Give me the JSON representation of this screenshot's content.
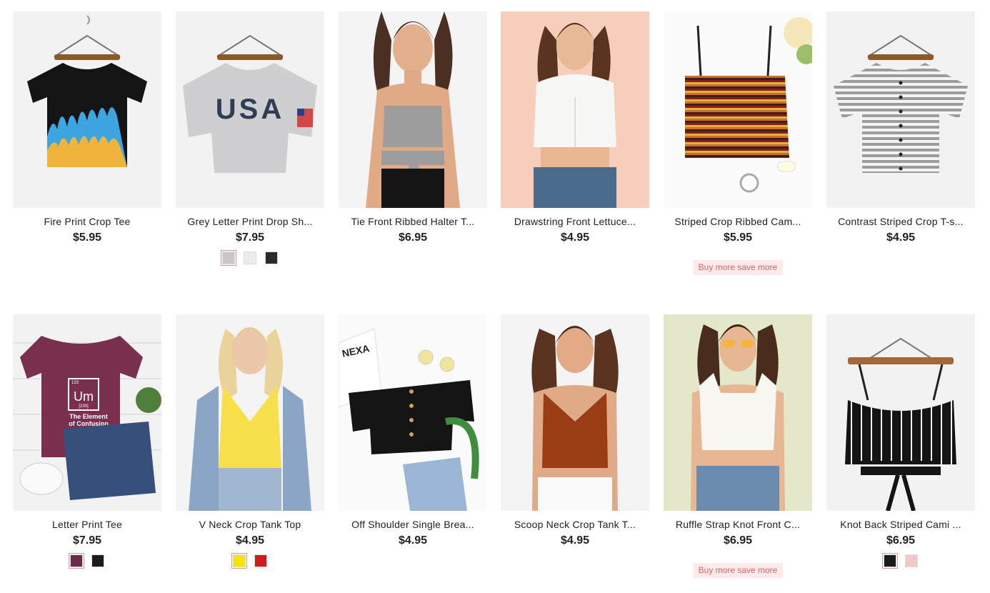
{
  "products": [
    {
      "title": "Fire Print Crop Tee",
      "price": "$5.95",
      "swatches": [],
      "promo": ""
    },
    {
      "title": "Grey Letter Print Drop Sh...",
      "price": "$7.95",
      "swatches": [
        "#c8c8cc",
        "#ececec",
        "#2a2a2a"
      ],
      "promo": ""
    },
    {
      "title": "Tie Front Ribbed Halter T...",
      "price": "$6.95",
      "swatches": [],
      "promo": ""
    },
    {
      "title": "Drawstring Front Lettuce...",
      "price": "$4.95",
      "swatches": [],
      "promo": ""
    },
    {
      "title": "Striped Crop Ribbed Cam...",
      "price": "$5.95",
      "swatches": [],
      "promo": "Buy more save more"
    },
    {
      "title": "Contrast Striped Crop T-s...",
      "price": "$4.95",
      "swatches": [],
      "promo": ""
    },
    {
      "title": "Letter Print Tee",
      "price": "$7.95",
      "swatches": [
        "#6b2b4b",
        "#1c1c1c"
      ],
      "promo": ""
    },
    {
      "title": "V Neck Crop Tank Top",
      "price": "$4.95",
      "swatches": [
        "#f2e600",
        "#cc1c1c"
      ],
      "promo": ""
    },
    {
      "title": "Off Shoulder Single Brea...",
      "price": "$4.95",
      "swatches": [],
      "promo": ""
    },
    {
      "title": "Scoop Neck Crop Tank T...",
      "price": "$4.95",
      "swatches": [],
      "promo": ""
    },
    {
      "title": "Ruffle Strap Knot Front C...",
      "price": "$6.95",
      "swatches": [],
      "promo": "Buy more save more"
    },
    {
      "title": "Knot Back Striped Cami ...",
      "price": "$6.95",
      "swatches": [
        "#1a1a1a",
        "#f1c8c8"
      ],
      "promo": ""
    }
  ],
  "image_text": {
    "usa": "USA",
    "um_number": "123",
    "um_symbol": "Um",
    "um_mass": "[230]",
    "um_line1": "The Element",
    "um_line2": "of Confusion",
    "card_text": "NEXA"
  },
  "colors": {
    "promo_bg": "#fdeaea",
    "promo_text": "#e26060",
    "placeholder_bg": "#f2f2f2"
  }
}
